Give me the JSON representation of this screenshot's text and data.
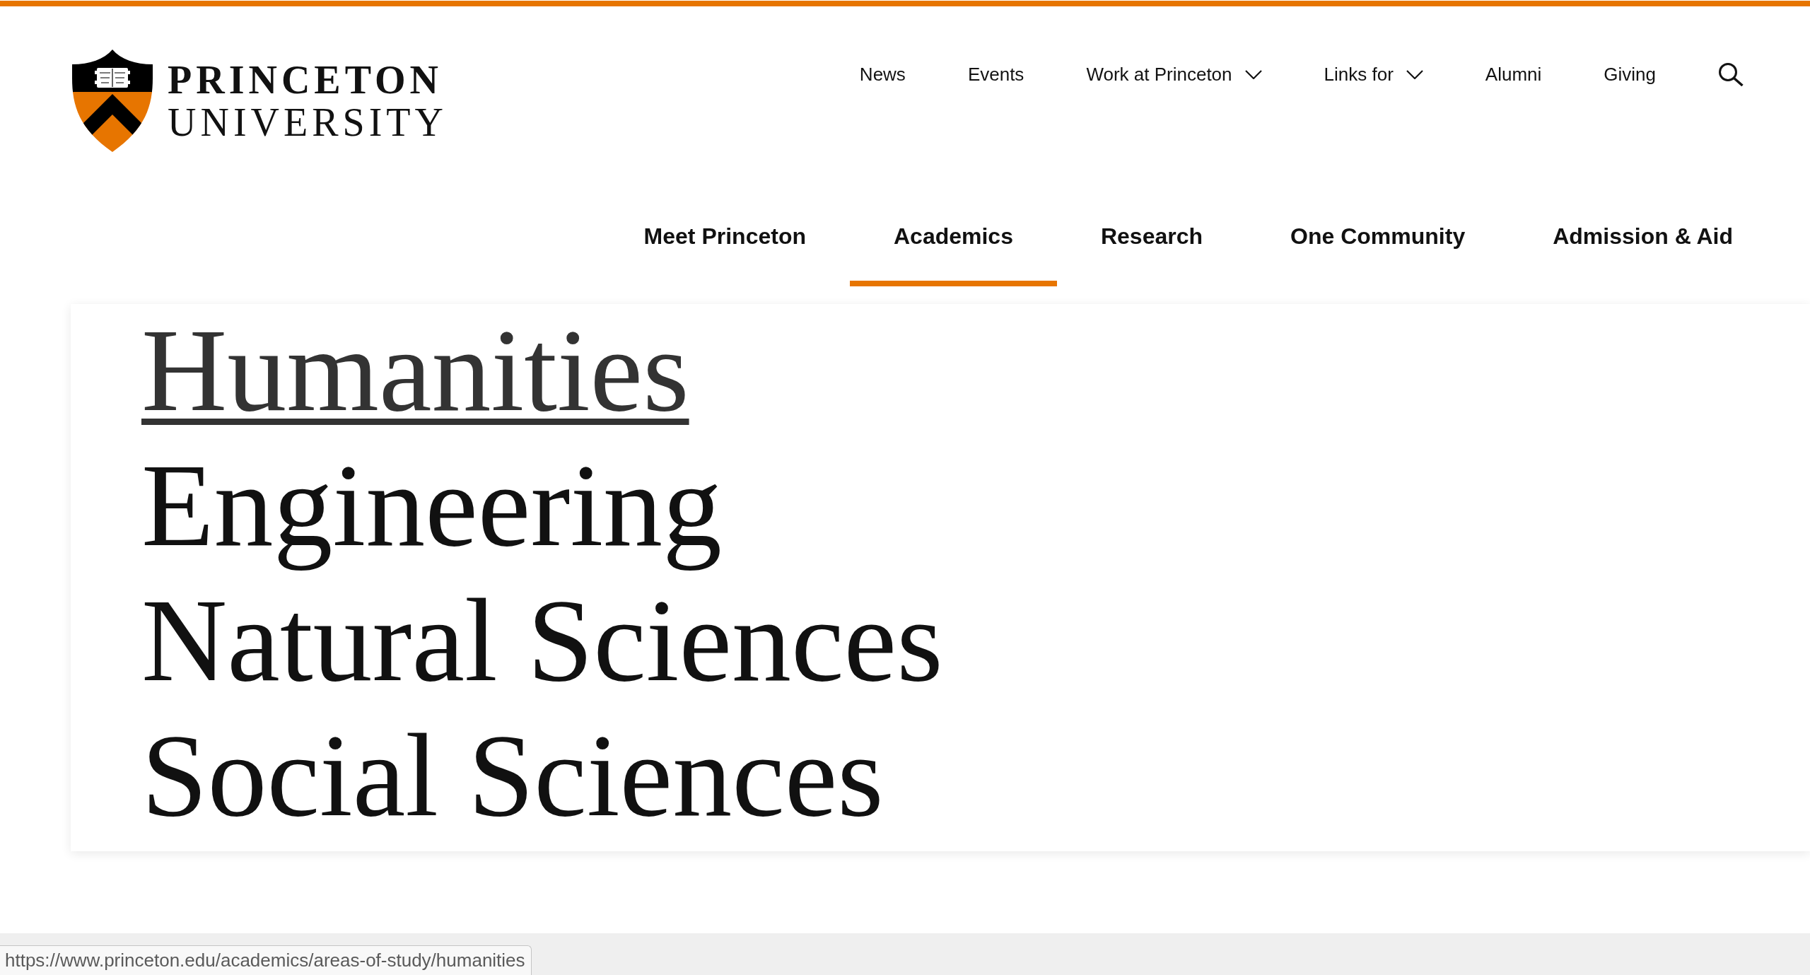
{
  "header": {
    "logo": {
      "name_line_1": "PRINCETON",
      "name_line_2": "UNIVERSITY"
    },
    "utility_nav": [
      {
        "label": "News",
        "kind": "link"
      },
      {
        "label": "Events",
        "kind": "link"
      },
      {
        "label": "Work at Princeton",
        "kind": "dropdown"
      },
      {
        "label": "Links for",
        "kind": "dropdown"
      },
      {
        "label": "Alumni",
        "kind": "link"
      },
      {
        "label": "Giving",
        "kind": "link"
      },
      {
        "kind": "search"
      }
    ],
    "main_nav": [
      {
        "label": "Meet Princeton",
        "selected": false
      },
      {
        "label": "Academics",
        "selected": true
      },
      {
        "label": "Research",
        "selected": false
      },
      {
        "label": "One Community",
        "selected": false
      },
      {
        "label": "Admission & Aid",
        "selected": false
      }
    ]
  },
  "menu_panel": {
    "links": [
      {
        "label": "Humanities",
        "hovered": true
      },
      {
        "label": "Engineering",
        "hovered": false
      },
      {
        "label": "Natural Sciences",
        "hovered": false
      },
      {
        "label": "Social Sciences",
        "hovered": false
      }
    ]
  },
  "status_url": "https://www.princeton.edu/academics/areas-of-study/humanities"
}
